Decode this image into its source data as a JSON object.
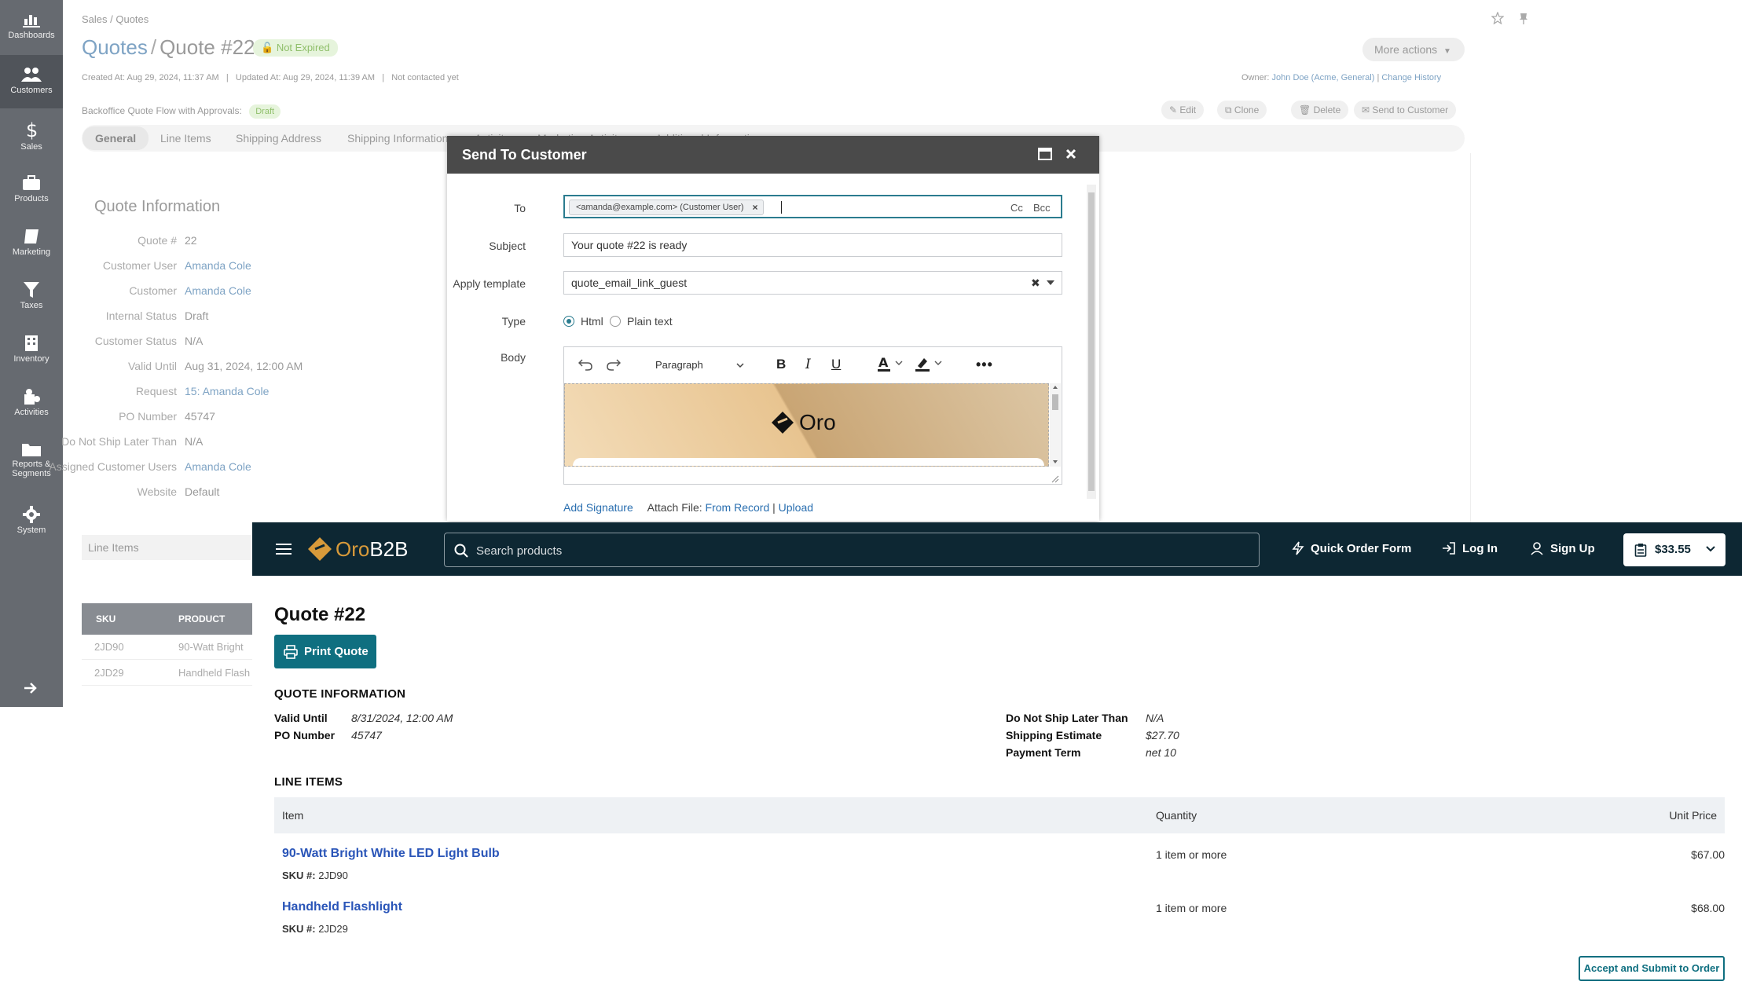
{
  "sidebar": {
    "items": [
      {
        "label": "Dashboards",
        "icon": "chart-bar-icon"
      },
      {
        "label": "Customers",
        "icon": "users-icon"
      },
      {
        "label": "Sales",
        "icon": "dollar-icon"
      },
      {
        "label": "Products",
        "icon": "briefcase-icon"
      },
      {
        "label": "Marketing",
        "icon": "book-icon"
      },
      {
        "label": "Taxes",
        "icon": "filter-icon"
      },
      {
        "label": "Inventory",
        "icon": "building-icon"
      },
      {
        "label": "Activities",
        "icon": "puzzle-icon"
      },
      {
        "label": "Reports &",
        "label2": "Segments",
        "icon": "folder-icon"
      },
      {
        "label": "System",
        "icon": "gear-icon"
      }
    ]
  },
  "admin": {
    "breadcrumb": "Sales / Quotes",
    "title_section": "Quotes",
    "title_slash": "/",
    "title_quote": "Quote #22",
    "status": "Not Expired",
    "more_actions": "More actions",
    "created_line": "Created At: Aug 29, 2024, 11:37 AM   |   Updated At: Aug 29, 2024, 11:39 AM   |   Not contacted yet",
    "owner_prefix": "Owner:",
    "owner_name": "John Doe (Acme, General)",
    "owner_sep": "|",
    "change_history": "Change History",
    "workflow_label": "Backoffice Quote Flow with Approvals:",
    "workflow_status": "Draft",
    "actions": {
      "edit": "Edit",
      "clone": "Clone",
      "delete": "Delete",
      "send": "Send to Customer"
    },
    "tabs": [
      "General",
      "Line Items",
      "Shipping Address",
      "Shipping Information",
      "Activity",
      "Marketing Activity",
      "Additional Information"
    ],
    "section_title": "Quote Information",
    "info": [
      {
        "label": "Quote #",
        "value": "22",
        "link": false
      },
      {
        "label": "Customer User",
        "value": "Amanda Cole",
        "link": true
      },
      {
        "label": "Customer",
        "value": "Amanda Cole",
        "link": true
      },
      {
        "label": "Internal Status",
        "value": "Draft",
        "link": false
      },
      {
        "label": "Customer Status",
        "value": "N/A",
        "link": false
      },
      {
        "label": "Valid Until",
        "value": "Aug 31, 2024, 12:00 AM",
        "link": false
      },
      {
        "label": "Request",
        "value": "15: Amanda Cole",
        "link": true
      },
      {
        "label": "PO Number",
        "value": "45747",
        "link": false
      },
      {
        "label": "Do Not Ship Later Than",
        "value": "N/A",
        "link": false
      },
      {
        "label": "Assigned Customer Users",
        "value": "Amanda Cole",
        "link": true
      },
      {
        "label": "Website",
        "value": "Default",
        "link": false
      }
    ],
    "line_items_title": "Line Items",
    "line_items_table": {
      "headers": [
        "SKU",
        "PRODUCT"
      ],
      "rows": [
        [
          "2JD90",
          "90-Watt Bright"
        ],
        [
          "2JD29",
          "Handheld Flash"
        ]
      ]
    }
  },
  "modal": {
    "title": "Send To Customer",
    "to_label": "To",
    "to_chip": "<amanda@example.com> (Customer User)",
    "cc": "Cc",
    "bcc": "Bcc",
    "subject_label": "Subject",
    "subject_value": "Your quote #22 is ready",
    "template_label": "Apply template",
    "template_value": "quote_email_link_guest",
    "type_label": "Type",
    "type_html": "Html",
    "type_plain": "Plain text",
    "body_label": "Body",
    "paragraph": "Paragraph",
    "logo_text": "Oro",
    "add_signature": "Add Signature",
    "attach_label": "Attach File:",
    "from_record": "From Record",
    "attach_sep": "|",
    "upload": "Upload"
  },
  "store": {
    "logo_oro": "Oro",
    "logo_b2b": "B2B",
    "search_placeholder": "Search products",
    "quick_order": "Quick Order Form",
    "log_in": "Log In",
    "sign_up": "Sign Up",
    "cart_total": "$33.55",
    "title": "Quote #22",
    "print_quote": "Print Quote",
    "quote_info_title": "QUOTE INFORMATION",
    "left_info": [
      {
        "label": "Valid Until",
        "value": "8/31/2024, 12:00 AM"
      },
      {
        "label": "PO Number",
        "value": "45747"
      }
    ],
    "right_info": [
      {
        "label": "Do Not Ship Later Than",
        "value": "N/A"
      },
      {
        "label": "Shipping Estimate",
        "value": "$27.70"
      },
      {
        "label": "Payment Term",
        "value": "net 10"
      }
    ],
    "line_items_title": "LINE ITEMS",
    "columns": {
      "item": "Item",
      "quantity": "Quantity",
      "unit_price": "Unit Price"
    },
    "items": [
      {
        "name": "90-Watt Bright White LED Light Bulb",
        "sku_label": "SKU #:",
        "sku": "2JD90",
        "qty": "1 item or more",
        "price": "$67.00"
      },
      {
        "name": "Handheld Flashlight",
        "sku_label": "SKU #:",
        "sku": "2JD29",
        "qty": "1 item or more",
        "price": "$68.00"
      }
    ],
    "accept_button": "Accept and Submit to Order"
  },
  "colors": {
    "sidebar_bg": "#666a70",
    "store_header": "#0d2733",
    "accent_teal": "#0f6f80",
    "logo_orange": "#d89a3a",
    "link_blue": "#2a55b8"
  }
}
